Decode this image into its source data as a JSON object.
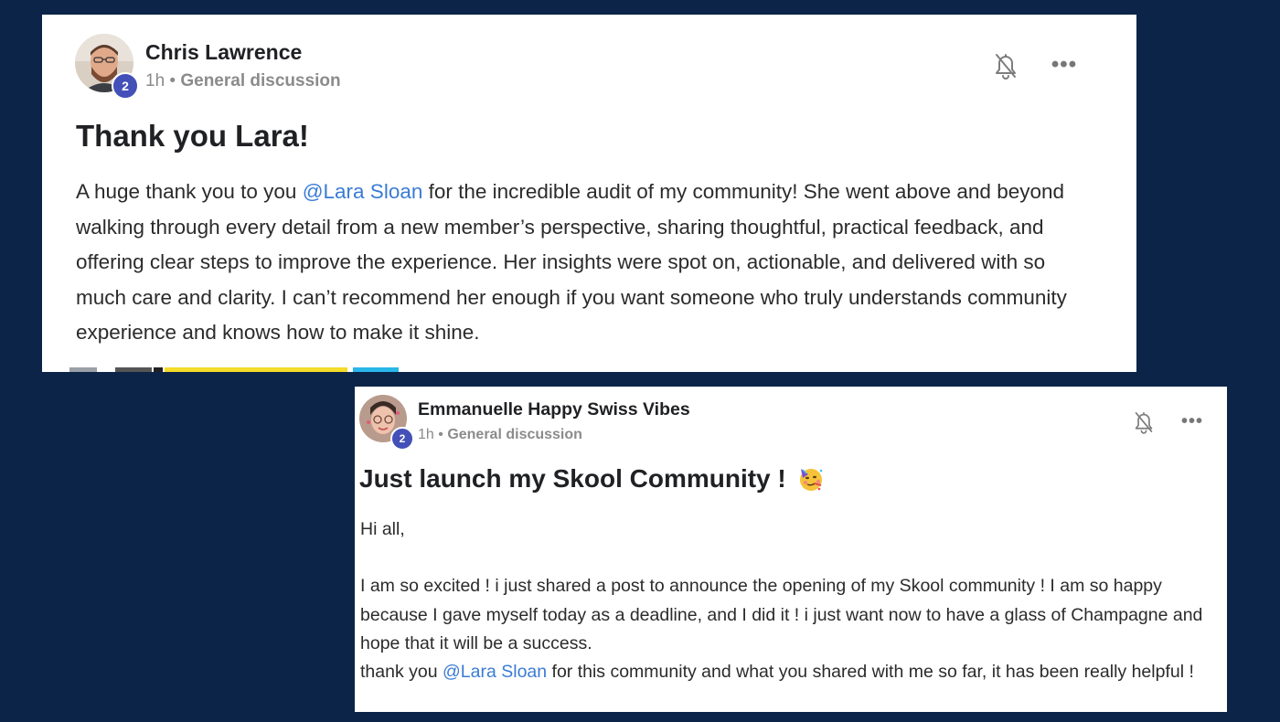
{
  "posts": [
    {
      "author": "Chris Lawrence",
      "level": "2",
      "time": "1h",
      "separator": "•",
      "category": "General discussion",
      "title": "Thank you Lara!",
      "body": {
        "before_mention": "A huge thank you to you ",
        "mention": "@Lara Sloan",
        "after_mention": " for the incredible audit of my community! She went above and beyond walking through every detail from a new member’s perspective, sharing thoughtful, practical feedback, and offering clear steps to improve the experience. Her insights were spot on, actionable, and delivered with so much care and clarity. I can’t recommend her enough if you want someone who truly understands community experience and knows how to make it shine."
      },
      "icons": {
        "bell": "bell-off-icon",
        "more": "more-dots-icon"
      },
      "more_glyph": "•••"
    },
    {
      "author": "Emmanuelle Happy Swiss Vibes",
      "level": "2",
      "time": "1h",
      "separator": "•",
      "category": "General discussion",
      "title": "Just launch my Skool Community !",
      "title_emoji_icon": "partying-face-icon",
      "body": {
        "greeting": "Hi all,",
        "paragraph": "I am so excited ! i just shared a post to announce the opening of my Skool community ! I am so happy because I gave myself today as a deadline, and I did it ! i just want now to have a glass of Champagne and hope that it will be a success.",
        "thanks_before": "thank you ",
        "mention": "@Lara Sloan",
        "thanks_after": " for this community and what you shared with me so far, it has been really helpful !"
      },
      "icons": {
        "bell": "bell-off-icon",
        "more": "more-dots-icon"
      },
      "more_glyph": "•••"
    }
  ],
  "colors": {
    "page_background": "#0c2448",
    "card_background": "#ffffff",
    "mention": "#3a7bd5",
    "level_badge": "#4350b8",
    "meta_text": "#8b8b8b"
  }
}
